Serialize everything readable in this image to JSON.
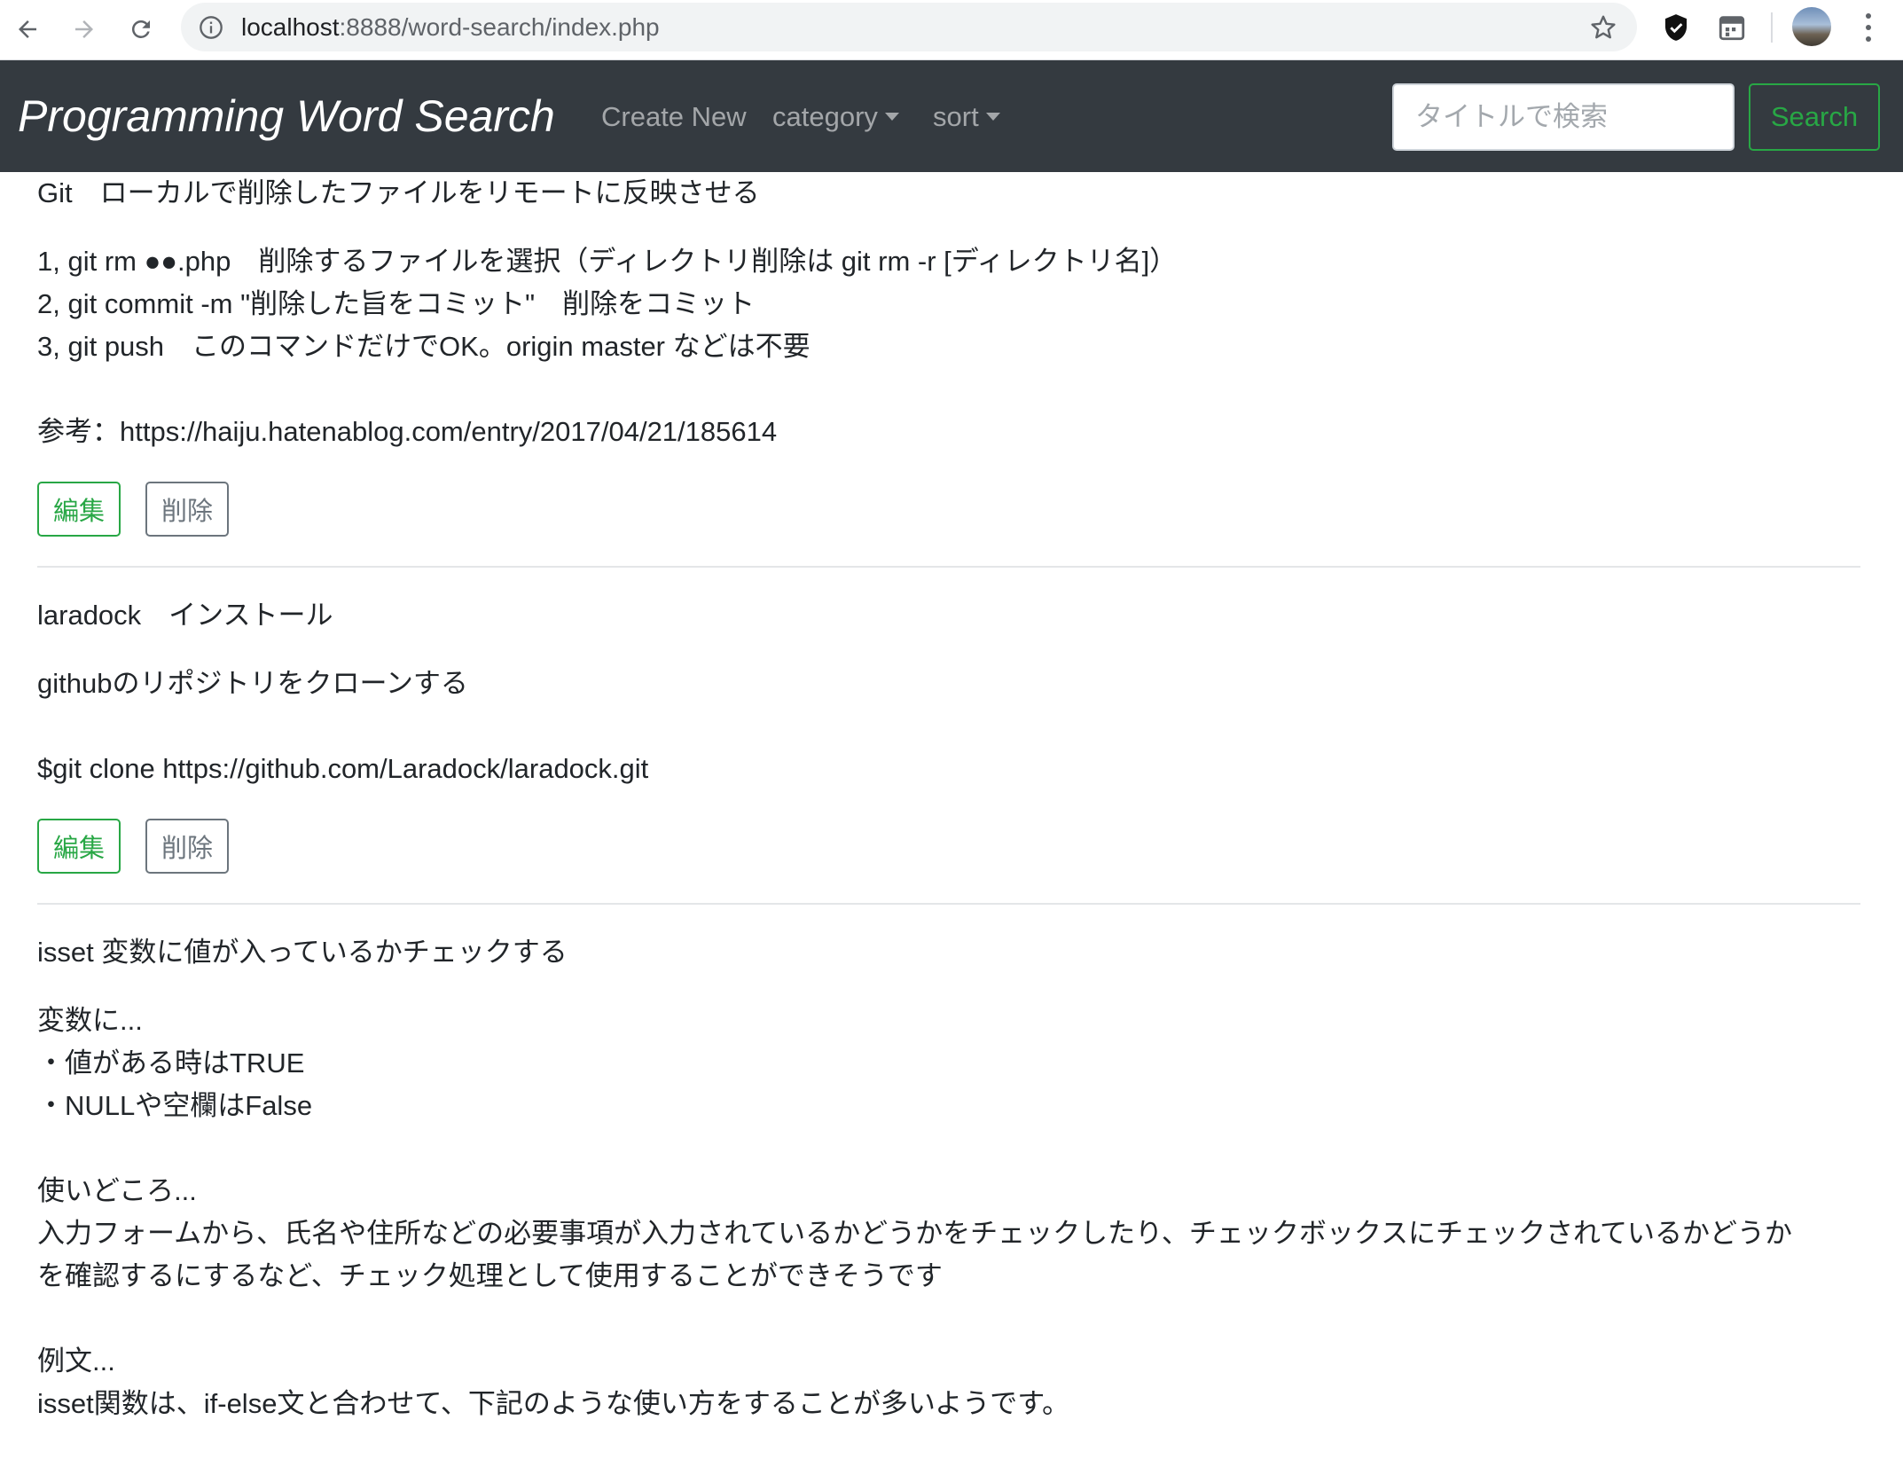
{
  "browser": {
    "url_host": "localhost",
    "url_rest": ":8888/word-search/index.php"
  },
  "navbar": {
    "brand": "Programming Word Search",
    "links": [
      {
        "label": "Create New"
      },
      {
        "label": "category"
      },
      {
        "label": "sort"
      }
    ],
    "search_placeholder": "タイトルで検索",
    "search_button": "Search"
  },
  "posts": [
    {
      "title": "Git　ローカルで削除したファイルをリモートに反映させる",
      "body": " 1, git rm ●●.php　削除するファイルを選択（ディレクトリ削除は git rm -r [ディレクトリ名]）\n2, git commit -m \"削除した旨をコミット\"　削除をコミット\n3, git push　このコマンドだけでOK。origin master などは不要\n\n参考：https://haiju.hatenablog.com/entry/2017/04/21/185614",
      "edit_label": "編集",
      "delete_label": "削除"
    },
    {
      "title": "laradock　インストール",
      "body": " githubのリポジトリをクローンする\n\n$git clone https://github.com/Laradock/laradock.git",
      "edit_label": "編集",
      "delete_label": "削除"
    },
    {
      "title": "isset 変数に値が入っているかチェックする",
      "body": " 変数に...\n・値がある時はTRUE\n・NULLや空欄はFalse\n\n使いどころ...\n入力フォームから、氏名や住所などの必要事項が入力されているかどうかをチェックしたり、チェックボックスにチェックされているかどうか\nを確認するにするなど、チェック処理として使用することができそうです\n\n例文...\nisset関数は、if-else文と合わせて、下記のような使い方をすることが多いようです。"
    }
  ]
}
